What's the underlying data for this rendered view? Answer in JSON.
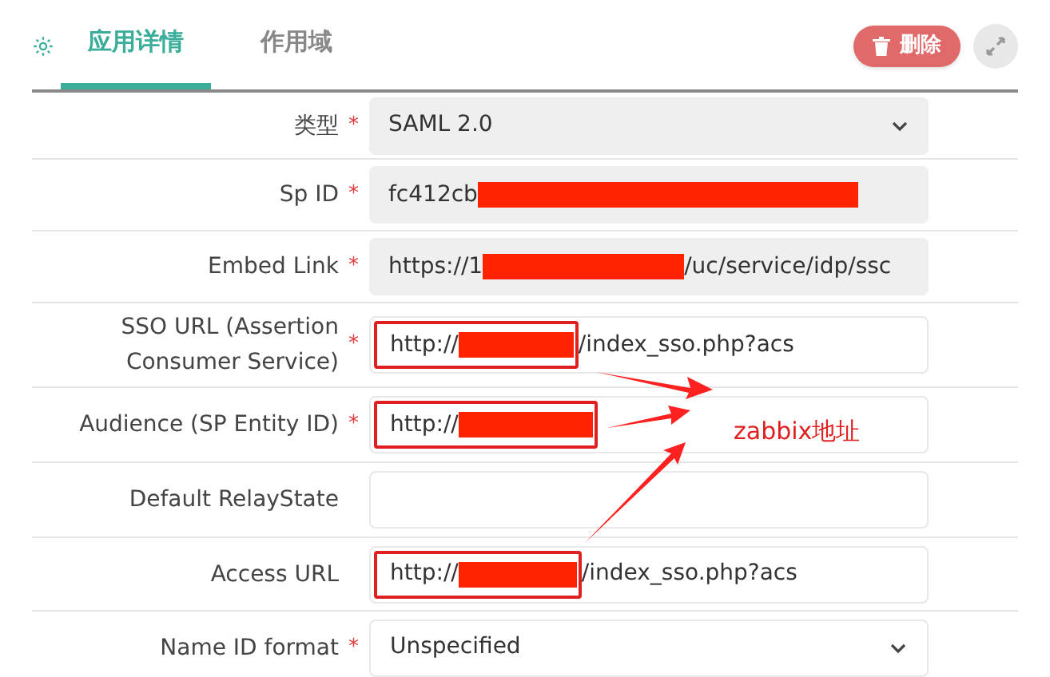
{
  "tabs": [
    {
      "label": "应用详情",
      "selected": true
    },
    {
      "label": "作用域",
      "selected": false
    }
  ],
  "delete_button": {
    "label": "删除"
  },
  "fields": [
    {
      "label": "类型",
      "required_mark": "*",
      "kind": "select",
      "value": "SAML 2.0",
      "disabled": true
    },
    {
      "label": "Sp ID",
      "required_mark": "*",
      "kind": "text",
      "value": "fc412cb",
      "redacted": true,
      "disabled": true
    },
    {
      "label": "Embed Link",
      "required_mark": "*",
      "kind": "text",
      "value": "https://1",
      "redacted": true,
      "value_suffix": "/uc/service/idp/ssc",
      "disabled": true
    },
    {
      "label": "SSO URL (Assertion Consumer Service)",
      "required_mark": "*",
      "kind": "text",
      "value": "http://",
      "redacted": true,
      "value_suffix": "/index_sso.php?acs",
      "disabled": false,
      "highlighted": true
    },
    {
      "label": "Audience (SP Entity ID)",
      "required_mark": "*",
      "kind": "text",
      "value": "http://",
      "redacted": true,
      "disabled": false,
      "highlighted": true
    },
    {
      "label": "Default RelayState",
      "kind": "text",
      "disabled": false
    },
    {
      "label": "Access URL",
      "kind": "text",
      "value": "http://",
      "redacted": true,
      "value_suffix": "/index_sso.php?acs",
      "disabled": false,
      "highlighted": true
    },
    {
      "label": "Name ID format",
      "required_mark": "*",
      "kind": "select",
      "value": "Unspecified",
      "disabled": false
    }
  ],
  "annotation": {
    "note": "zabbix地址"
  }
}
